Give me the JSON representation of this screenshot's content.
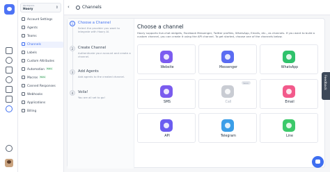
{
  "workspace": {
    "caption": "Workspace",
    "name": "Hoory"
  },
  "sidebar": {
    "items": [
      {
        "label": "Account Settings"
      },
      {
        "label": "Agents"
      },
      {
        "label": "Teams"
      },
      {
        "label": "Channels",
        "active": true
      },
      {
        "label": "Labels"
      },
      {
        "label": "Custom Attributes"
      },
      {
        "label": "Automation",
        "badge": "Beta"
      },
      {
        "label": "Macros",
        "badge": "Beta"
      },
      {
        "label": "Canned Responses"
      },
      {
        "label": "Webhooks"
      },
      {
        "label": "Applications"
      },
      {
        "label": "Billing"
      }
    ]
  },
  "header": {
    "title": "Channels",
    "back_icon": "chevron-left-icon",
    "title_icon": "gear-icon"
  },
  "steps": [
    {
      "number": "1",
      "title": "Choose a Channel",
      "desc": "Select the provider you want to integrate with Hoory AI.",
      "current": true
    },
    {
      "number": "2",
      "title": "Create Channel",
      "desc": "Authenticate your account and create a channel."
    },
    {
      "number": "3",
      "title": "Add Agents",
      "desc": "Add agents to the created channel."
    },
    {
      "number": "4",
      "title": "Voila!",
      "desc": "You are all set to go!"
    }
  ],
  "main": {
    "heading": "Choose a channel",
    "description": "Hoory supports live-chat widgets, Facebook Messenger, Twitter profiles, WhatsApp, Emails, etc., as channels. If you want to build a custom channel, you can create it using the API channel. To get started, choose one of the channels below."
  },
  "channels": [
    {
      "label": "Website",
      "color": "#7c5cf0"
    },
    {
      "label": "Messenger",
      "color": "#5b6cf2"
    },
    {
      "label": "WhatsApp",
      "color": "#2fc26b"
    },
    {
      "label": "SMS",
      "color": "#7a5cee"
    },
    {
      "label": "Call",
      "color": "#c9ccd3",
      "badge": "Soon",
      "disabled": true
    },
    {
      "label": "Email",
      "color": "#f25a8b"
    },
    {
      "label": "API",
      "color": "#6b5cf0"
    },
    {
      "label": "Telegram",
      "color": "#3b9ee8"
    },
    {
      "label": "Line",
      "color": "#3cc96a"
    }
  ],
  "feedback_label": "Feedback"
}
